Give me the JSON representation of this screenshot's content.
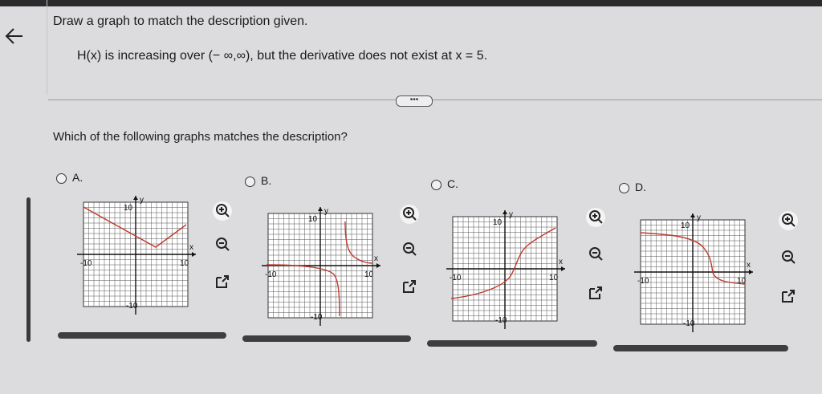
{
  "header": {
    "back_icon": "arrow-left-icon",
    "instruction": "Draw a graph to match the description given.",
    "description": "H(x) is increasing over (− ∞,∞), but the derivative does not exist at x = 5.",
    "more_label": "•••"
  },
  "question": "Which of the following graphs matches the description?",
  "options": [
    {
      "letter": "A.",
      "selected": false,
      "graph_shape": "v-shape with corner near (5, -3)"
    },
    {
      "letter": "B.",
      "selected": false,
      "graph_shape": "decreasing curve with vertical asymptote"
    },
    {
      "letter": "C.",
      "selected": false,
      "graph_shape": "increasing curve with vertical tangent at x = 5"
    },
    {
      "letter": "D.",
      "selected": false,
      "graph_shape": "decreasing curve with vertical tangent"
    }
  ],
  "graph_labels": {
    "tick_pos": "10",
    "tick_neg": "-10",
    "x_axis": "x",
    "y_axis": "y"
  },
  "tools": [
    "zoom-in-icon",
    "zoom-out-icon",
    "pop-out-icon"
  ],
  "colors": {
    "curve": "#c0392b",
    "grid": "#333333",
    "panel": "#ffffff"
  }
}
